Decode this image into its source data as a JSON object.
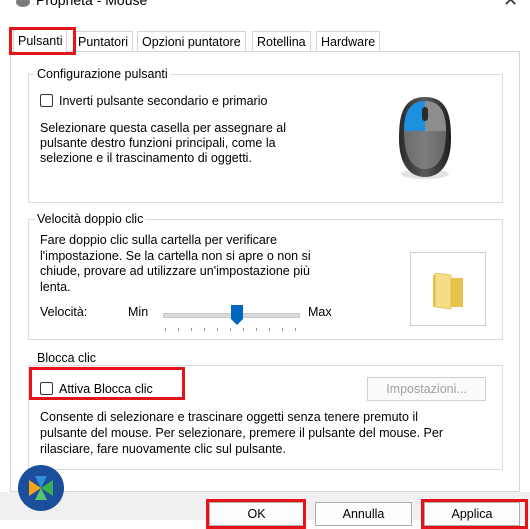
{
  "window": {
    "title": "Proprietà - Mouse",
    "close_glyph": "✕"
  },
  "tabs": [
    {
      "label": "Pulsanti",
      "active": true
    },
    {
      "label": "Puntatori"
    },
    {
      "label": "Opzioni puntatore"
    },
    {
      "label": "Rotellina"
    },
    {
      "label": "Hardware"
    }
  ],
  "button_config": {
    "group_label": "Configurazione pulsanti",
    "checkbox_label": "Inverti pulsante secondario e primario",
    "checked": false,
    "description_lines": [
      "Selezionare questa casella per assegnare al",
      "pulsante destro funzioni principali, come la",
      "selezione e il trascinamento di oggetti."
    ]
  },
  "double_click": {
    "group_label": "Velocità doppio clic",
    "description_lines": [
      "Fare doppio clic sulla cartella per verificare",
      "l'impostazione. Se la cartella non si apre o non si",
      "chiude, provare ad utilizzare un'impostazione più",
      "lenta."
    ],
    "speed_label": "Velocità:",
    "min_label": "Min",
    "max_label": "Max",
    "slider_value_fraction": 0.55
  },
  "click_lock": {
    "group_label": "Blocca clic",
    "checkbox_label": "Attiva Blocca clic",
    "checked": false,
    "settings_button": "Impostazioni...",
    "description_lines": [
      "Consente di selezionare e trascinare oggetti senza tenere premuto il",
      "pulsante del mouse. Per selezionare, premere il pulsante del mouse. Per",
      "rilasciare, fare nuovamente clic sul pulsante."
    ]
  },
  "footer": {
    "ok_label": "OK",
    "cancel_label": "Annulla",
    "apply_label": "Applica"
  },
  "colors": {
    "highlight_red": "#e5141a",
    "mouse_accent": "#1e90e0",
    "folder_yellow": "#f2d36b"
  }
}
